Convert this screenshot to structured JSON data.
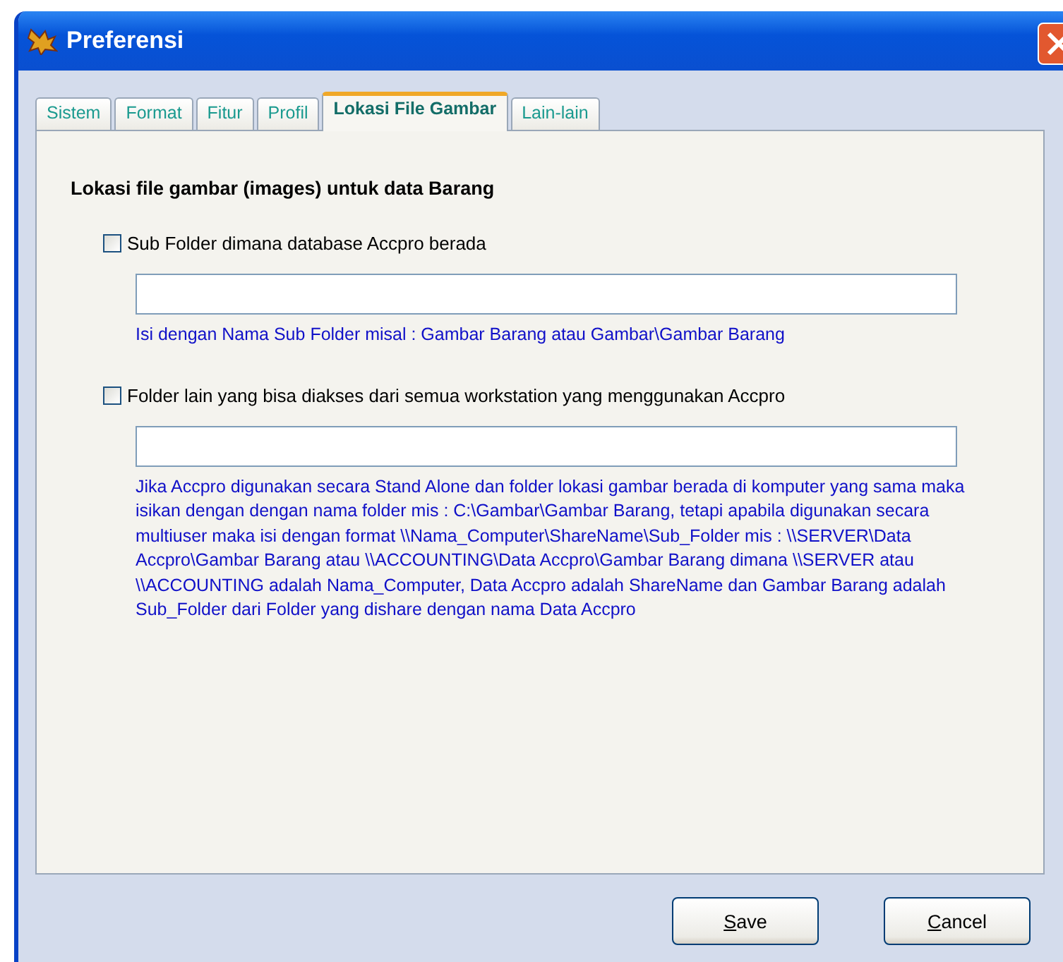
{
  "window": {
    "title": "Preferensi"
  },
  "tabs": [
    {
      "label": "Sistem",
      "selected": false
    },
    {
      "label": "Format",
      "selected": false
    },
    {
      "label": "Fitur",
      "selected": false
    },
    {
      "label": "Profil",
      "selected": false
    },
    {
      "label": "Lokasi File Gambar",
      "selected": true
    },
    {
      "label": "Lain-lain",
      "selected": false
    }
  ],
  "heading": "Lokasi  file gambar (images) untuk data Barang",
  "options": [
    {
      "label": "Sub Folder dimana database Accpro berada",
      "checked": false,
      "hint": "Isi dengan Nama Sub Folder misal : Gambar Barang atau Gambar\\Gambar Barang"
    },
    {
      "label": "Folder lain yang bisa diakses dari semua workstation yang menggunakan Accpro",
      "checked": false,
      "hint": "Jika Accpro digunakan secara Stand Alone dan folder lokasi gambar berada di komputer yang sama maka isikan dengan dengan nama folder mis : C:\\Gambar\\Gambar Barang, tetapi apabila digunakan secara multiuser maka isi dengan format \\\\Nama_Computer\\ShareName\\Sub_Folder mis : \\\\SERVER\\Data Accpro\\Gambar Barang atau \\\\ACCOUNTING\\Data Accpro\\Gambar Barang dimana \\\\SERVER atau \\\\ACCOUNTING adalah Nama_Computer, Data Accpro adalah ShareName dan Gambar Barang adalah Sub_Folder dari Folder yang dishare dengan nama Data Accpro"
    }
  ],
  "buttons": [
    "Save",
    "Cancel"
  ]
}
